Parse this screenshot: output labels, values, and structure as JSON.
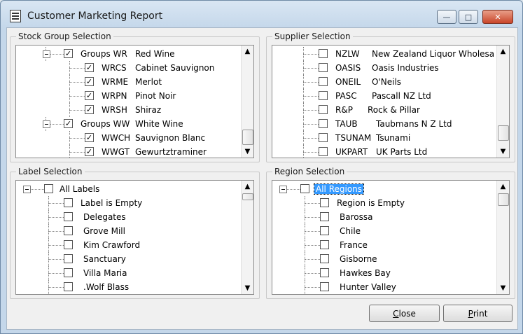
{
  "window": {
    "title": "Customer Marketing Report",
    "controls": {
      "minimize": "—",
      "maximize": "□",
      "close": "✕"
    }
  },
  "stock": {
    "label": "Stock Group Selection",
    "rows": [
      {
        "code": "Groups WR",
        "name": "Red Wine",
        "checked": true,
        "group": true
      },
      {
        "code": "WRCS",
        "name": "Cabinet Sauvignon",
        "checked": true
      },
      {
        "code": "WRME",
        "name": "Merlot",
        "checked": true
      },
      {
        "code": "WRPN",
        "name": "Pinot Noir",
        "checked": true
      },
      {
        "code": "WRSH",
        "name": "Shiraz",
        "checked": true
      },
      {
        "code": "Groups WW",
        "name": "White Wine",
        "checked": true,
        "group": true
      },
      {
        "code": "WWCH",
        "name": "Sauvignon Blanc",
        "checked": true
      },
      {
        "code": "WWGT",
        "name": "Gewurtztraminer",
        "checked": true
      }
    ]
  },
  "supplier": {
    "label": "Supplier Selection",
    "rows": [
      {
        "code": "NZLW",
        "name": "New Zealand Liquor Wholesa"
      },
      {
        "code": "OASIS",
        "name": "Oasis Industries"
      },
      {
        "code": "ONEIL",
        "name": "O'Neils"
      },
      {
        "code": "PASC",
        "name": "Pascall NZ Ltd"
      },
      {
        "code": "R&P",
        "name": "Rock & Pillar"
      },
      {
        "code": "TAUB",
        "name": "Taubmans N Z Ltd"
      },
      {
        "code": "TSUNAM",
        "name": "Tsunami"
      },
      {
        "code": "UKPART",
        "name": "UK Parts Ltd"
      }
    ]
  },
  "labelsel": {
    "label": "Label Selection",
    "root": "All Labels",
    "rows": [
      "Label is Empty",
      "Delegates",
      "Grove Mill",
      "Kim Crawford",
      "Sanctuary",
      "Villa Maria",
      ".Wolf Blass"
    ]
  },
  "region": {
    "label": "Region Selection",
    "root": "All Regions",
    "rows": [
      "Region is Empty",
      "Barossa",
      "Chile",
      "France",
      "Gisborne",
      "Hawkes Bay",
      "Hunter Valley"
    ]
  },
  "buttons": {
    "close_prefix": "",
    "close_hot": "C",
    "close_rest": "lose",
    "print_hot": "P",
    "print_rest": "rint"
  },
  "icons": {
    "check": "✓",
    "up": "▲",
    "down": "▼"
  }
}
